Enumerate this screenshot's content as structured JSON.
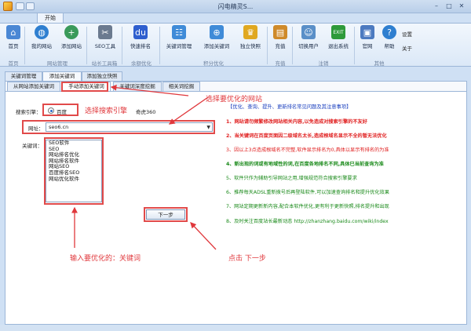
{
  "window": {
    "title": "闪电精灵S..."
  },
  "ribbon_tab": "开始",
  "ribbon": {
    "buttons": [
      {
        "label": "首页",
        "icon": "home-icon"
      },
      {
        "label": "我的网站",
        "icon": "globe-icon"
      },
      {
        "label": "添加网站",
        "icon": "add-site-icon"
      },
      {
        "label": "SEO工具",
        "icon": "tools-icon"
      },
      {
        "label": "快速排名",
        "icon": "baidu-icon"
      },
      {
        "label": "关键词管理",
        "icon": "network-icon"
      },
      {
        "label": "添加关键词",
        "icon": "add-keyword-icon"
      },
      {
        "label": "独立快照",
        "icon": "trophy-icon"
      },
      {
        "label": "充值",
        "icon": "recharge-icon"
      },
      {
        "label": "切换用户",
        "icon": "users-icon"
      },
      {
        "label": "退出系统",
        "icon": "exit-icon"
      },
      {
        "label": "官网",
        "icon": "official-site-icon"
      },
      {
        "label": "帮助",
        "icon": "help-icon"
      },
      {
        "label": "设置",
        "icon": "settings-icon"
      },
      {
        "label": "关于",
        "icon": "about-icon"
      }
    ],
    "groups": [
      "首页",
      "网站管理",
      "站长工具箱",
      "余额优化",
      "积分优化",
      "充值",
      "注销",
      "其他"
    ]
  },
  "tabs_level1": [
    "关键词管理",
    "添加关键词",
    "添加独立快照"
  ],
  "tabs_level2": [
    "从网站添加关键词",
    "手动添加关键词",
    "关键词深度挖掘",
    "相关词挖掘"
  ],
  "form": {
    "engine_label": "搜索引擎：",
    "engine_option1": "百度",
    "engine_option2": "奇虎360",
    "url_label": "网址：",
    "url_value": "seo6.cn",
    "keywords_label": "关键词：",
    "keywords": [
      "SEO软件",
      "SEO",
      "网站排名优化",
      "网站排名软件",
      "网站SEO",
      "百度排名SEO",
      "网站优化软件"
    ],
    "next_button": "下一步"
  },
  "notes": {
    "title": "【优化、查询、提升、更新排名常见问题及其注意事项】",
    "items": [
      {
        "text": "1、网站请勿频繁修改网站相关内容,以免造成对搜索引擎的不友好",
        "color": "#e02020",
        "bold": true
      },
      {
        "text": "2、当关键词在百度页面因二级域名太长,造成根域名显示不全的暂无法优化",
        "color": "#e02020",
        "bold": true
      },
      {
        "text": "3、因以上3点造成根域名不完整,软件显示排名为0,具体以显示有排名的为准",
        "color": "#e02020",
        "bold": false
      },
      {
        "text": "4、新出现的词或有地域性的词,在百度各地排名不同,具体已当前查询为准",
        "color": "#1a8a1a",
        "bold": true
      },
      {
        "text": "5、软件只作为辅助引导网站之用,增强规范符合搜索引擎要求",
        "color": "#1a8a1a",
        "bold": false
      },
      {
        "text": "6、推荐每天ADSL重新拨号后再登陆软件,可以加速查询排名和提升优化效果",
        "color": "#1a8a1a",
        "bold": false
      },
      {
        "text": "7、网站定期更新新内容,配合本软件优化,更有利于更新快照,排名提升和出现",
        "color": "#1a8a1a",
        "bold": false
      },
      {
        "text": "8、及时关注百度站长最新动态 http://zhanzhang.baidu.com/wiki/index",
        "color": "#1a8a1a",
        "bold": false
      }
    ]
  },
  "annotations": {
    "select_engine": "选择搜索引擎",
    "select_site": "选择要优化的网站",
    "input_keywords": "输入要优化的：关键词",
    "click_next": "点击 下一步"
  },
  "colors": {
    "annotation": "#e0383c",
    "ribbon_bg": "#dbe8f7",
    "accent_blue": "#1a3fbf"
  }
}
